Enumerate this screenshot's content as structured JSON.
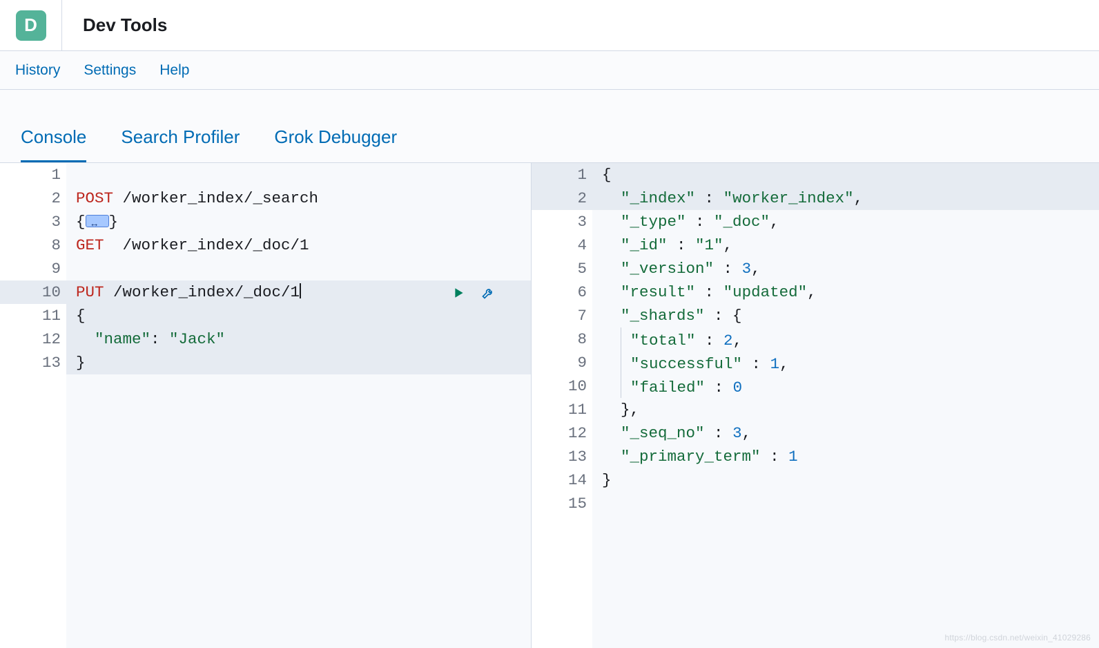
{
  "app": {
    "icon_letter": "D",
    "title": "Dev Tools"
  },
  "links": {
    "history": "History",
    "settings": "Settings",
    "help": "Help"
  },
  "tabs": {
    "console": "Console",
    "search_profiler": "Search Profiler",
    "grok_debugger": "Grok Debugger"
  },
  "request_editor": {
    "lines": [
      {
        "n": "1",
        "content": []
      },
      {
        "n": "2",
        "content": [
          {
            "cls": "method",
            "t": "POST"
          },
          {
            "cls": "path",
            "t": " /worker_index/_search"
          }
        ]
      },
      {
        "n": "3",
        "fold": "▸",
        "content": [
          {
            "cls": "punct",
            "t": "{"
          },
          {
            "cls": "badge"
          },
          {
            "cls": "punct",
            "t": "}"
          }
        ]
      },
      {
        "n": "8",
        "content": [
          {
            "cls": "method",
            "t": "GET"
          },
          {
            "cls": "path",
            "t": "  /worker_index/_doc/1"
          }
        ]
      },
      {
        "n": "9",
        "content": []
      },
      {
        "n": "10",
        "active": true,
        "cursor": true,
        "content": [
          {
            "cls": "method",
            "t": "PUT"
          },
          {
            "cls": "path",
            "t": " /worker_index/_doc/1"
          }
        ]
      },
      {
        "n": "11",
        "fold": "▾",
        "active_block": true,
        "content": [
          {
            "cls": "punct",
            "t": "{"
          }
        ]
      },
      {
        "n": "12",
        "active_block": true,
        "content": [
          {
            "cls": "punct",
            "t": "  "
          },
          {
            "cls": "key",
            "t": "\"name\""
          },
          {
            "cls": "punct",
            "t": ": "
          },
          {
            "cls": "str",
            "t": "\"Jack\""
          }
        ]
      },
      {
        "n": "13",
        "fold": "▴",
        "active_block": true,
        "content": [
          {
            "cls": "punct",
            "t": "}"
          }
        ]
      }
    ]
  },
  "response_editor": {
    "lines": [
      {
        "n": "1",
        "fold": "▾",
        "hl": true,
        "content": [
          {
            "cls": "punct",
            "t": "{"
          }
        ]
      },
      {
        "n": "2",
        "hl": true,
        "content": [
          {
            "cls": "punct",
            "t": "  "
          },
          {
            "cls": "key",
            "t": "\"_index\""
          },
          {
            "cls": "punct",
            "t": " : "
          },
          {
            "cls": "str",
            "t": "\"worker_index\""
          },
          {
            "cls": "punct",
            "t": ","
          }
        ]
      },
      {
        "n": "3",
        "content": [
          {
            "cls": "punct",
            "t": "  "
          },
          {
            "cls": "key",
            "t": "\"_type\""
          },
          {
            "cls": "punct",
            "t": " : "
          },
          {
            "cls": "str",
            "t": "\"_doc\""
          },
          {
            "cls": "punct",
            "t": ","
          }
        ]
      },
      {
        "n": "4",
        "content": [
          {
            "cls": "punct",
            "t": "  "
          },
          {
            "cls": "key",
            "t": "\"_id\""
          },
          {
            "cls": "punct",
            "t": " : "
          },
          {
            "cls": "str",
            "t": "\"1\""
          },
          {
            "cls": "punct",
            "t": ","
          }
        ]
      },
      {
        "n": "5",
        "content": [
          {
            "cls": "punct",
            "t": "  "
          },
          {
            "cls": "key",
            "t": "\"_version\""
          },
          {
            "cls": "punct",
            "t": " : "
          },
          {
            "cls": "num",
            "t": "3"
          },
          {
            "cls": "punct",
            "t": ","
          }
        ]
      },
      {
        "n": "6",
        "content": [
          {
            "cls": "punct",
            "t": "  "
          },
          {
            "cls": "key",
            "t": "\"result\""
          },
          {
            "cls": "punct",
            "t": " : "
          },
          {
            "cls": "str",
            "t": "\"updated\""
          },
          {
            "cls": "punct",
            "t": ","
          }
        ]
      },
      {
        "n": "7",
        "fold": "▾",
        "content": [
          {
            "cls": "punct",
            "t": "  "
          },
          {
            "cls": "key",
            "t": "\"_shards\""
          },
          {
            "cls": "punct",
            "t": " : {"
          }
        ]
      },
      {
        "n": "8",
        "content": [
          {
            "cls": "punct",
            "t": "  "
          },
          {
            "cls": "guide"
          },
          {
            "cls": "key",
            "t": "\"total\""
          },
          {
            "cls": "punct",
            "t": " : "
          },
          {
            "cls": "num",
            "t": "2"
          },
          {
            "cls": "punct",
            "t": ","
          }
        ]
      },
      {
        "n": "9",
        "content": [
          {
            "cls": "punct",
            "t": "  "
          },
          {
            "cls": "guide"
          },
          {
            "cls": "key",
            "t": "\"successful\""
          },
          {
            "cls": "punct",
            "t": " : "
          },
          {
            "cls": "num",
            "t": "1"
          },
          {
            "cls": "punct",
            "t": ","
          }
        ]
      },
      {
        "n": "10",
        "content": [
          {
            "cls": "punct",
            "t": "  "
          },
          {
            "cls": "guide"
          },
          {
            "cls": "key",
            "t": "\"failed\""
          },
          {
            "cls": "punct",
            "t": " : "
          },
          {
            "cls": "num",
            "t": "0"
          }
        ]
      },
      {
        "n": "11",
        "fold": "▴",
        "content": [
          {
            "cls": "punct",
            "t": "  },"
          }
        ]
      },
      {
        "n": "12",
        "content": [
          {
            "cls": "punct",
            "t": "  "
          },
          {
            "cls": "key",
            "t": "\"_seq_no\""
          },
          {
            "cls": "punct",
            "t": " : "
          },
          {
            "cls": "num",
            "t": "3"
          },
          {
            "cls": "punct",
            "t": ","
          }
        ]
      },
      {
        "n": "13",
        "content": [
          {
            "cls": "punct",
            "t": "  "
          },
          {
            "cls": "key",
            "t": "\"_primary_term\""
          },
          {
            "cls": "punct",
            "t": " : "
          },
          {
            "cls": "num",
            "t": "1"
          }
        ]
      },
      {
        "n": "14",
        "fold": "▴",
        "content": [
          {
            "cls": "punct",
            "t": "}"
          }
        ]
      },
      {
        "n": "15",
        "content": []
      }
    ]
  },
  "watermark": "https://blog.csdn.net/weixin_41029286"
}
